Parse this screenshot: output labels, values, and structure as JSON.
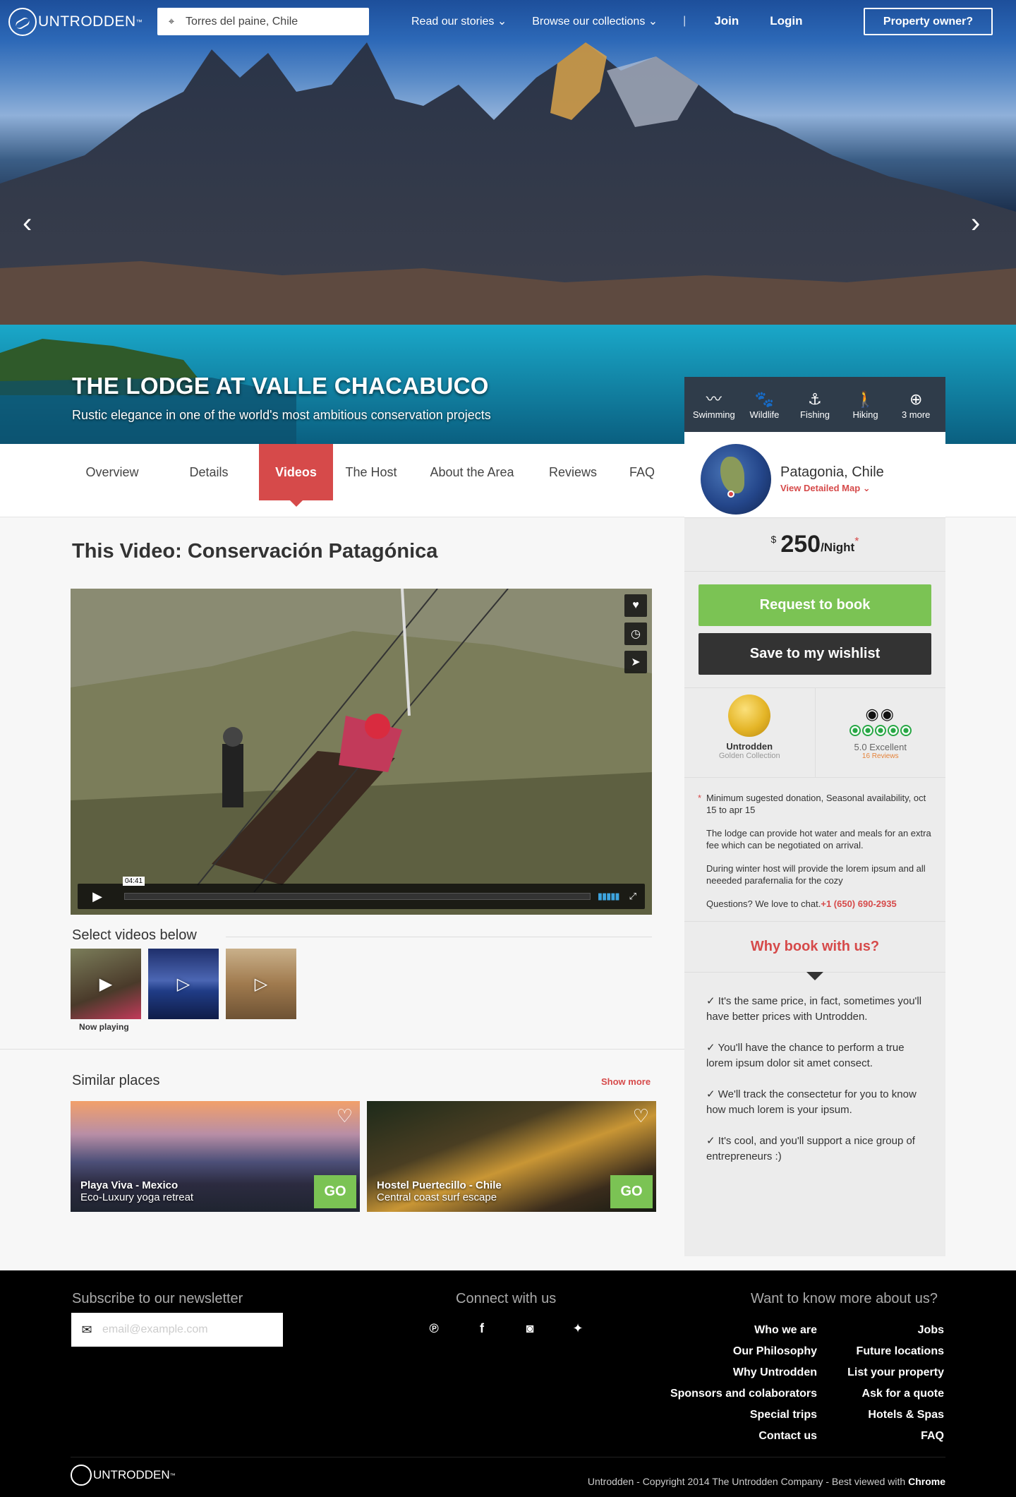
{
  "header": {
    "logo_text": "UNTRODDEN",
    "logo_tm": "™",
    "search_value": "Torres del paine, Chile",
    "nav": [
      "Read our stories ⌄",
      "Browse our collections ⌄"
    ],
    "separator": "|",
    "join": "Join",
    "login": "Login",
    "owner_button": "Property owner?"
  },
  "hero": {
    "title": "THE LODGE AT VALLE CHACABUCO",
    "subtitle": "Rustic elegance in one of the world's most ambitious conservation projects",
    "prev_arrow": "‹",
    "next_arrow": "›"
  },
  "activities": [
    {
      "label": "Swimming",
      "icon": "swimming-icon",
      "glyph": "〰"
    },
    {
      "label": "Wildlife",
      "icon": "paw-icon",
      "glyph": "🐾"
    },
    {
      "label": "Fishing",
      "icon": "fishing-hook-icon",
      "glyph": "⚓"
    },
    {
      "label": "Hiking",
      "icon": "hiker-icon",
      "glyph": "🚶"
    },
    {
      "label": "3 more",
      "icon": "plus-circle-icon",
      "glyph": "⊕"
    }
  ],
  "tabs": [
    "Overview",
    "Details",
    "Videos",
    "The Host",
    "About the Area",
    "Reviews",
    "FAQ"
  ],
  "active_tab": "Videos",
  "video": {
    "heading_prefix": "This Video: ",
    "heading_title": "Conservación Patagónica",
    "time": "04:41",
    "select_label": "Select videos below",
    "now_playing": "Now playing"
  },
  "similar": {
    "title": "Similar places",
    "show_more": "Show more",
    "cards": [
      {
        "name": "Playa Viva - Mexico",
        "desc": "Eco-Luxury yoga retreat",
        "go": "GO"
      },
      {
        "name": "Hostel Puertecillo - Chile",
        "desc": "Central coast surf escape",
        "go": "GO"
      }
    ]
  },
  "sidebar": {
    "location": "Patagonia, Chile",
    "map_link": "View Detailed Map ⌄",
    "currency": "$",
    "price": "250",
    "per": "/Night",
    "asterisk": "*",
    "book": "Request to book",
    "wishlist": "Save to my wishlist",
    "award1_title": "Untrodden",
    "award1_sub": "Golden Collection",
    "award2_rating": "5.0 Excellent",
    "award2_reviews": "16 Reviews",
    "note_star": "*",
    "note1": "Minimum sugested donation, Seasonal availability, oct 15 to apr 15",
    "note2": "The lodge can provide hot water and meals for an extra fee which can be negotiated on arrival.",
    "note3": "During winter host will provide the lorem ipsum and all neeeded parafernalia for the cozy",
    "questions": "Questions? We love to chat.",
    "phone": "+1 (650) 690-2935",
    "why_title": "Why book with us?",
    "reasons": [
      "✓ It's the same price, in fact, sometimes you'll have better prices with Untrodden.",
      "✓ You'll have the chance to perform a true lorem ipsum dolor sit amet consect.",
      "✓ We'll track the consectetur for you to know how much lorem is your ipsum.",
      "✓ It's cool, and you'll support a nice group of entrepreneurs :)"
    ]
  },
  "footer": {
    "newsletter_title": "Subscribe to our newsletter",
    "email_placeholder": "email@example.com",
    "connect_title": "Connect with us",
    "social": [
      {
        "icon": "pinterest-icon",
        "glyph": "℗"
      },
      {
        "icon": "facebook-icon",
        "glyph": "f"
      },
      {
        "icon": "instagram-icon",
        "glyph": "◙"
      },
      {
        "icon": "twitter-icon",
        "glyph": "✦"
      }
    ],
    "more_title": "Want to know more about us?",
    "links_col1": [
      "Who we are",
      "Our Philosophy",
      "Why Untrodden",
      "Sponsors and colaborators",
      "Special trips",
      "Contact us"
    ],
    "links_col2": [
      "Jobs",
      "Future locations",
      "List your property",
      "Ask for a quote",
      "Hotels & Spas",
      "FAQ"
    ],
    "logo_text": "UNTRODDEN",
    "logo_tm": "™",
    "copyright": "Untrodden - Copyright 2014 The Untrodden Company - Best viewed with ",
    "browser": "Chrome"
  },
  "colors": {
    "accent_red": "#d64a4a",
    "book_green": "#7bc354",
    "dark": "#333333"
  }
}
